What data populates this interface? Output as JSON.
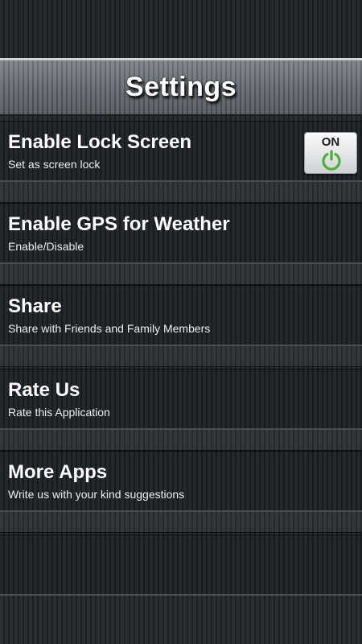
{
  "header": {
    "title": "Settings"
  },
  "settings": [
    {
      "title": "Enable Lock Screen",
      "subtitle": "Set as screen lock",
      "toggle": {
        "state_label": "ON",
        "icon": "power-icon",
        "icon_color": "#4caf3a"
      }
    },
    {
      "title": "Enable GPS for Weather",
      "subtitle": "Enable/Disable"
    },
    {
      "title": "Share",
      "subtitle": "Share with Friends and Family Members"
    },
    {
      "title": "Rate Us",
      "subtitle": "Rate this Application"
    },
    {
      "title": "More Apps",
      "subtitle": "Write us with your kind suggestions"
    }
  ],
  "colors": {
    "background": "#24272b",
    "text": "#ffffff",
    "accent_green": "#4caf3a"
  }
}
